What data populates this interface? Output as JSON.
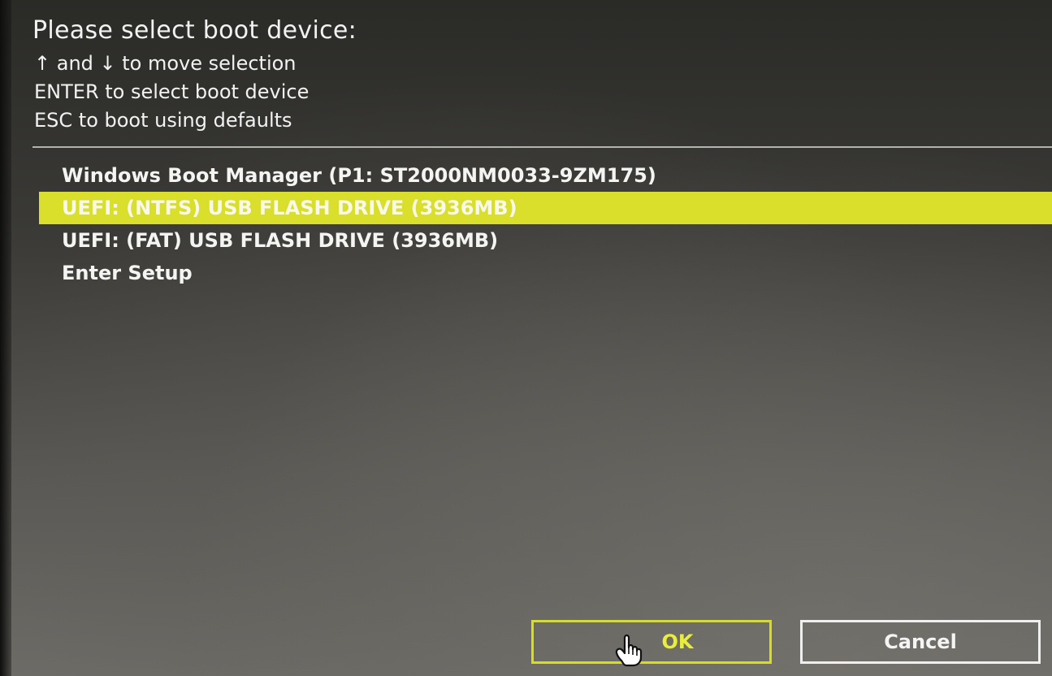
{
  "screen": {
    "title": "Please select boot device:",
    "hints": [
      "↑ and ↓ to move selection",
      "ENTER to select boot device",
      "ESC to boot using defaults"
    ]
  },
  "boot_devices": [
    {
      "label": "Windows Boot Manager (P1: ST2000NM0033-9ZM175)",
      "selected": false
    },
    {
      "label": "UEFI: (NTFS)  USB FLASH DRIVE (3936MB)",
      "selected": true
    },
    {
      "label": "UEFI: (FAT)  USB FLASH DRIVE (3936MB)",
      "selected": false
    },
    {
      "label": "Enter Setup",
      "selected": false
    }
  ],
  "buttons": {
    "ok_label": "OK",
    "cancel_label": "Cancel"
  },
  "colors": {
    "highlight": "#d9df2a",
    "ok_accent": "#e9ee3a",
    "text": "#f2f2f2"
  },
  "icons": {
    "pointer": "hand-pointer-icon"
  }
}
